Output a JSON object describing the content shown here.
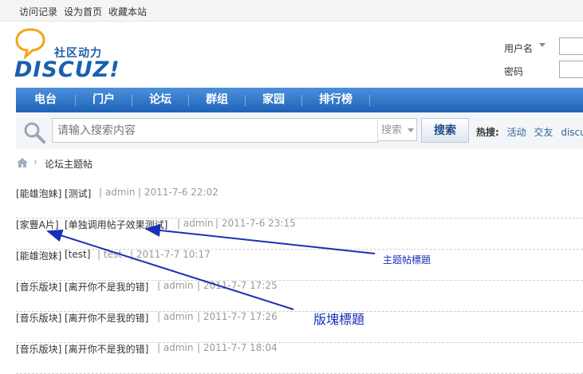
{
  "topbar": {
    "links": [
      "访问记录",
      "设为首页",
      "收藏本站"
    ]
  },
  "logo": {
    "subtitle": "社区动力",
    "title": "DISCUZ!"
  },
  "login": {
    "username_label": "用户名",
    "password_label": "密码"
  },
  "nav": {
    "items": [
      "电台",
      "门户",
      "论坛",
      "群组",
      "家园",
      "排行榜"
    ]
  },
  "search": {
    "placeholder": "请输入搜索内容",
    "type": "搜索",
    "button": "搜索",
    "hot_label": "热搜:",
    "hot_items": [
      "活动",
      "交友",
      "discuz"
    ]
  },
  "breadcrumb": {
    "current": "论坛主题帖"
  },
  "threads": [
    {
      "category": "[能雄泡妹]",
      "subject": "[测试]",
      "author": "| admin",
      "date": "| 2011-7-6 22:02"
    },
    {
      "category": "[家豐A片]",
      "subject": "[单独调用帖子效果测试]",
      "author": "| admin",
      "date": "| 2011-7-6 23:15"
    },
    {
      "category": "[能雄泡妹]",
      "subject": "[test]",
      "author": "| test",
      "date": "| 2011-7-7 10:17"
    },
    {
      "category": "[音乐版块]",
      "subject": "[离开你不是我的错]",
      "author": "| admin",
      "date": "| 2011-7-7 17:25"
    },
    {
      "category": "[音乐版块]",
      "subject": "[离开你不是我的错]",
      "author": "| admin",
      "date": "| 2011-7-7 17:26"
    },
    {
      "category": "[音乐版块]",
      "subject": "[离开你不是我的错]",
      "author": "| admin",
      "date": "| 2011-7-7 18:04"
    }
  ],
  "annotations": {
    "thread_title": "主题帖標題",
    "board_title": "版塊標題"
  },
  "colors": {
    "nav_blue": "#1f63b8",
    "annotation_blue": "#1b2fb6",
    "link_blue": "#336699"
  }
}
